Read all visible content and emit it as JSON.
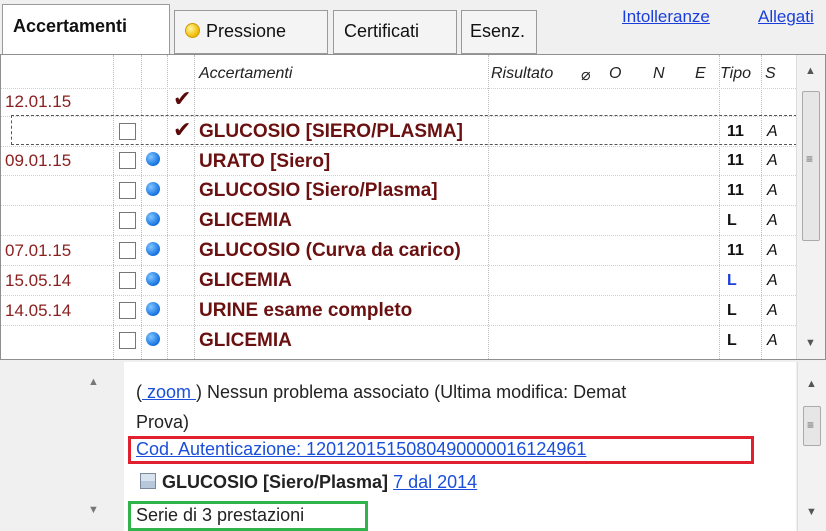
{
  "tabs": [
    {
      "label": "Accertamenti",
      "active": true
    },
    {
      "label": "Pressione",
      "icon": "yellow-dot-icon"
    },
    {
      "label": "Certificati"
    },
    {
      "label": "Esenz."
    }
  ],
  "top_links": [
    "Intolleranze",
    "Allegati"
  ],
  "columns": {
    "accertamenti": "Accertamenti",
    "risultato": "Risultato",
    "o": "O",
    "n": "N",
    "e": "E",
    "tipo": "Tipo",
    "s": "S"
  },
  "rows": [
    {
      "date": "12.01.15",
      "name": "",
      "tipo": "",
      "s": "",
      "checked": true
    },
    {
      "date": "",
      "name": "GLUCOSIO [SIERO/PLASMA]",
      "tipo": "11",
      "s": "A",
      "checked": true
    },
    {
      "date": "09.01.15",
      "name": "URATO [Siero]",
      "tipo": "11",
      "s": "A"
    },
    {
      "date": "",
      "name": "GLUCOSIO [Siero/Plasma]",
      "tipo": "11",
      "s": "A"
    },
    {
      "date": "",
      "name": "GLICEMIA",
      "tipo": "L",
      "s": "A"
    },
    {
      "date": "07.01.15",
      "name": "GLUCOSIO (Curva da carico)",
      "tipo": "11",
      "s": "A"
    },
    {
      "date": "15.05.14",
      "name": "GLICEMIA",
      "tipo": "L",
      "s": "A",
      "tipo_color": "#1a3edb"
    },
    {
      "date": "14.05.14",
      "name": "URINE esame completo",
      "tipo": "L",
      "s": "A"
    },
    {
      "date": "",
      "name": "GLICEMIA",
      "tipo": "L",
      "s": "A"
    }
  ],
  "detail": {
    "zoom_label": " zoom ",
    "line1_text": "Nessun problema associato (Ultima modifica: Demat",
    "line2_text": "Prova)",
    "auth_code": "Cod. Autenticazione: 1201201515080490000016124961",
    "exam_name": "GLUCOSIO [Siero/Plasma]",
    "exam_link": "7 dal 2014",
    "series_text": "Serie di 3 prestazioni"
  },
  "colors": {
    "exam_name": "#6b1010",
    "date": "#8b2020",
    "link": "#1a4edb",
    "highlight_red": "#e0202e",
    "highlight_green": "#2fb34a"
  }
}
